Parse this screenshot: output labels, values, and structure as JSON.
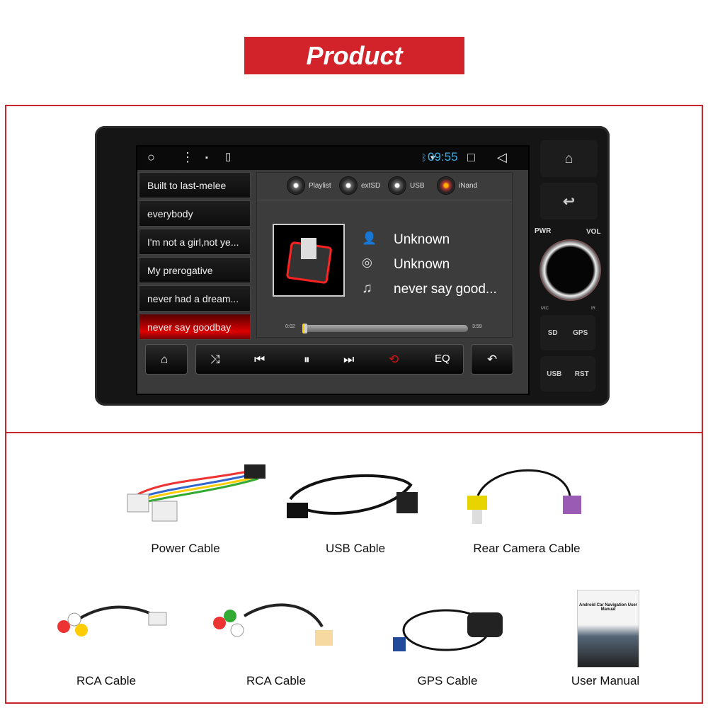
{
  "banner": {
    "title": "Product"
  },
  "screen": {
    "status": {
      "time": "09:55"
    },
    "playlist": [
      "Built to last-melee",
      "everybody",
      "I'm not a girl,not ye...",
      "My prerogative",
      "never had a dream...",
      "never say goodbay"
    ],
    "sources": [
      {
        "label": "Playlist",
        "active": false
      },
      {
        "label": "extSD",
        "active": false
      },
      {
        "label": "USB",
        "active": false
      },
      {
        "label": "iNand",
        "active": true
      }
    ],
    "track": {
      "artist": "Unknown",
      "album": "Unknown",
      "title": "never say good..."
    },
    "progress": {
      "elapsed": "0:02",
      "total": "3:59"
    },
    "controls": {
      "eq": "EQ"
    },
    "accent": "#d2232a"
  },
  "hardware": {
    "pwr": "PWR",
    "vol": "VOL",
    "mic": "MIC",
    "ir": "IR",
    "sd": "SD",
    "gps": "GPS",
    "usb": "USB",
    "rst": "RST"
  },
  "accessories": [
    {
      "label": "Power Cable"
    },
    {
      "label": "USB Cable"
    },
    {
      "label": "Rear Camera Cable"
    },
    {
      "label": "RCA Cable"
    },
    {
      "label": "RCA Cable"
    },
    {
      "label": "GPS Cable"
    },
    {
      "label": "User Manual"
    }
  ],
  "manual": {
    "cover_text": "Android Car Navigation User Manual"
  }
}
